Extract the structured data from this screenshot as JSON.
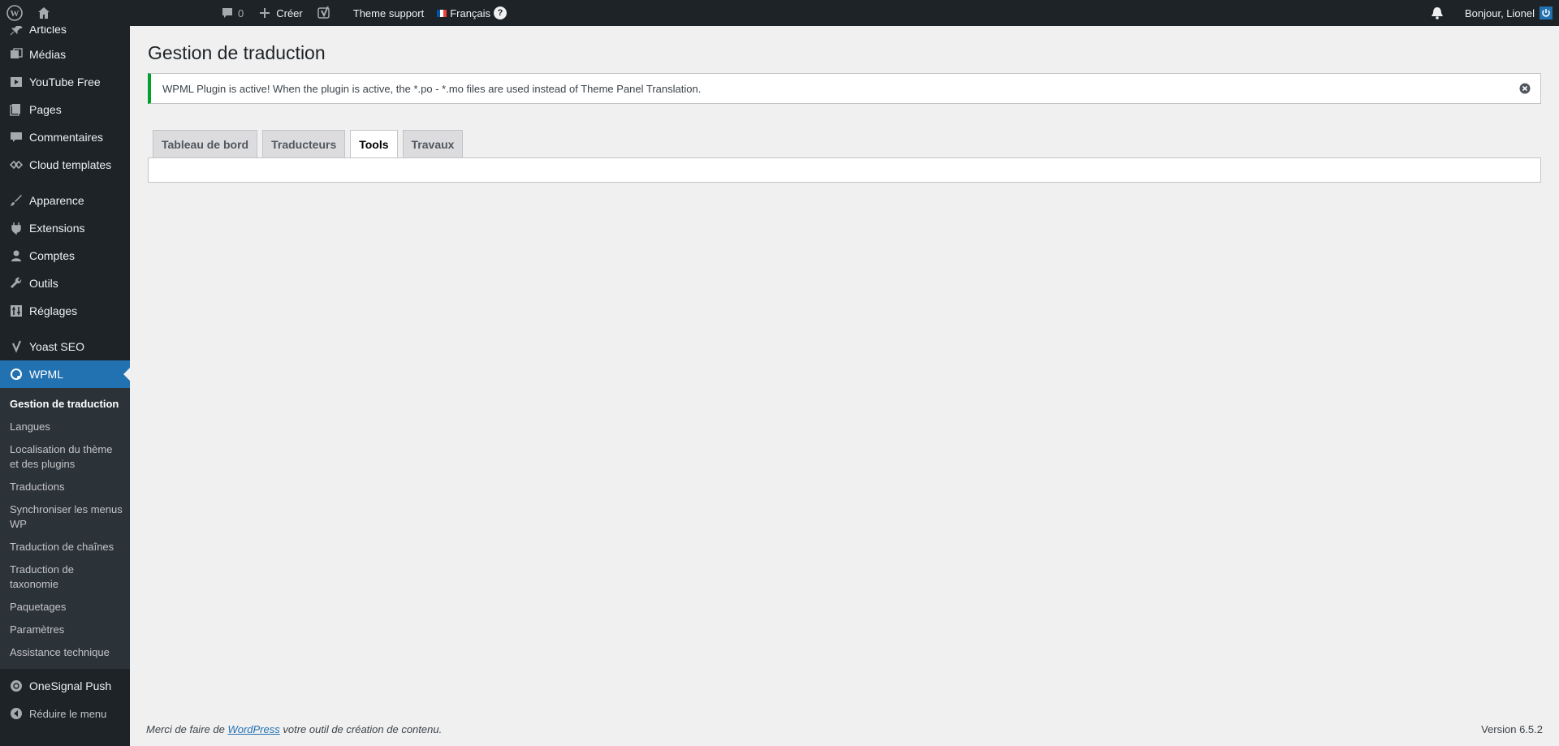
{
  "adminbar": {
    "comments_count": "0",
    "create_label": "Créer",
    "theme_support_label": "Theme support",
    "language_label": "Français",
    "help_badge": "?",
    "greeting": "Bonjour, Lionel"
  },
  "sidebar": {
    "items": [
      {
        "label": "Articles",
        "icon": "pin-icon"
      },
      {
        "label": "Médias",
        "icon": "media-icon"
      },
      {
        "label": "YouTube Free",
        "icon": "youtube-icon"
      },
      {
        "label": "Pages",
        "icon": "pages-icon"
      },
      {
        "label": "Commentaires",
        "icon": "comments-icon"
      },
      {
        "label": "Cloud templates",
        "icon": "cloud-templates-icon"
      },
      {
        "label": "Apparence",
        "icon": "appearance-icon"
      },
      {
        "label": "Extensions",
        "icon": "plugins-icon"
      },
      {
        "label": "Comptes",
        "icon": "users-icon"
      },
      {
        "label": "Outils",
        "icon": "tools-icon"
      },
      {
        "label": "Réglages",
        "icon": "settings-icon"
      },
      {
        "label": "Yoast SEO",
        "icon": "yoast-icon"
      },
      {
        "label": "WPML",
        "icon": "wpml-icon"
      },
      {
        "label": "OneSignal Push",
        "icon": "onesignal-icon"
      },
      {
        "label": "Réduire le menu",
        "icon": "collapse-icon"
      }
    ],
    "submenu": [
      "Gestion de traduction",
      "Langues",
      "Localisation du thème et des plugins",
      "Traductions",
      "Synchroniser les menus WP",
      "Traduction de chaînes",
      "Traduction de taxonomie",
      "Paquetages",
      "Paramètres",
      "Assistance technique"
    ]
  },
  "main": {
    "title": "Gestion de traduction",
    "notice": "WPML Plugin is active! When the plugin is active, the *.po - *.mo files are used instead of Theme Panel Translation.",
    "tabs": [
      "Tableau de bord",
      "Traducteurs",
      "Tools",
      "Travaux"
    ],
    "active_tab": "Tools"
  },
  "footer": {
    "text_before": "Merci de faire de ",
    "link": "WordPress",
    "text_after": " votre outil de création de contenu.",
    "version": "Version 6.5.2"
  },
  "colors": {
    "accent": "#2271b1",
    "sidebar_bg": "#1d2327",
    "notice_success": "#00a32a"
  }
}
